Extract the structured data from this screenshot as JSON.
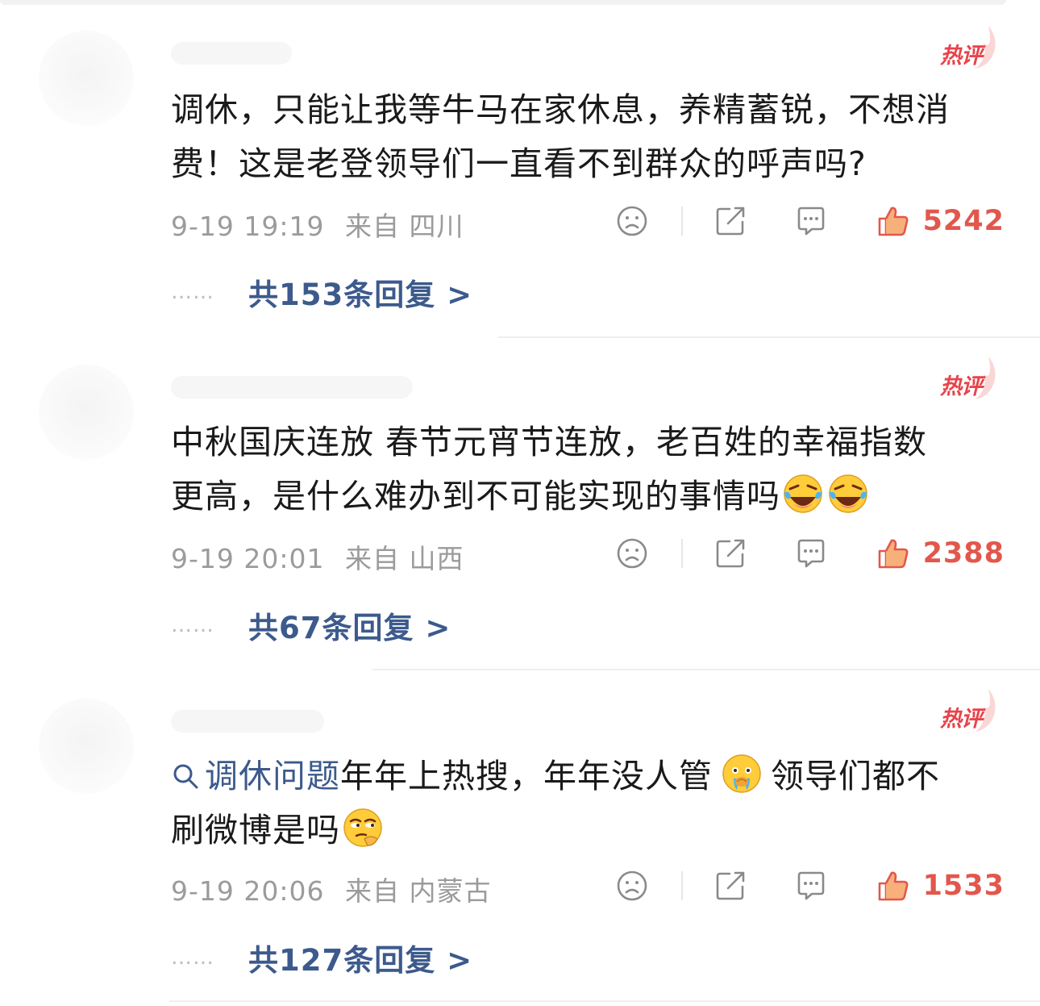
{
  "comments": [
    {
      "badge": "热评",
      "text_line1": "调休，只能让我等牛马在家休息，养精蓄锐，不想消",
      "text_line2": "费！这是老登领导们一直看不到群众的呼声吗?",
      "time": "9-19 19:19",
      "location": "来自 四川",
      "likes": "5242",
      "replies": "共153条回复 >"
    },
    {
      "badge": "热评",
      "text_line1": "中秋国庆连放 春节元宵节连放，老百姓的幸福指数",
      "text_line2": "更高，是什么难办到不可能实现的事情吗",
      "emojis": [
        "laugh-cry-emoji",
        "laugh-cry-emoji"
      ],
      "time": "9-19 20:01",
      "location": "来自 山西",
      "likes": "2388",
      "replies": "共67条回复 >"
    },
    {
      "badge": "热评",
      "topic": "调休问题",
      "text_line1_rest": "年年上热搜，年年没人管",
      "text_line1_tail": "领导们都不",
      "text_line2": "刷微博是吗",
      "emojis": [
        "sad-cry-emoji",
        "side-eye-emoji"
      ],
      "time": "9-19 20:06",
      "location": "来自 内蒙古",
      "likes": "1533",
      "replies": "共127条回复 >"
    }
  ],
  "dots": "……",
  "colors": {
    "like": "#e2574c",
    "link": "#3c5a8c",
    "meta": "#9b9b9b",
    "badge": "#e8434a"
  }
}
